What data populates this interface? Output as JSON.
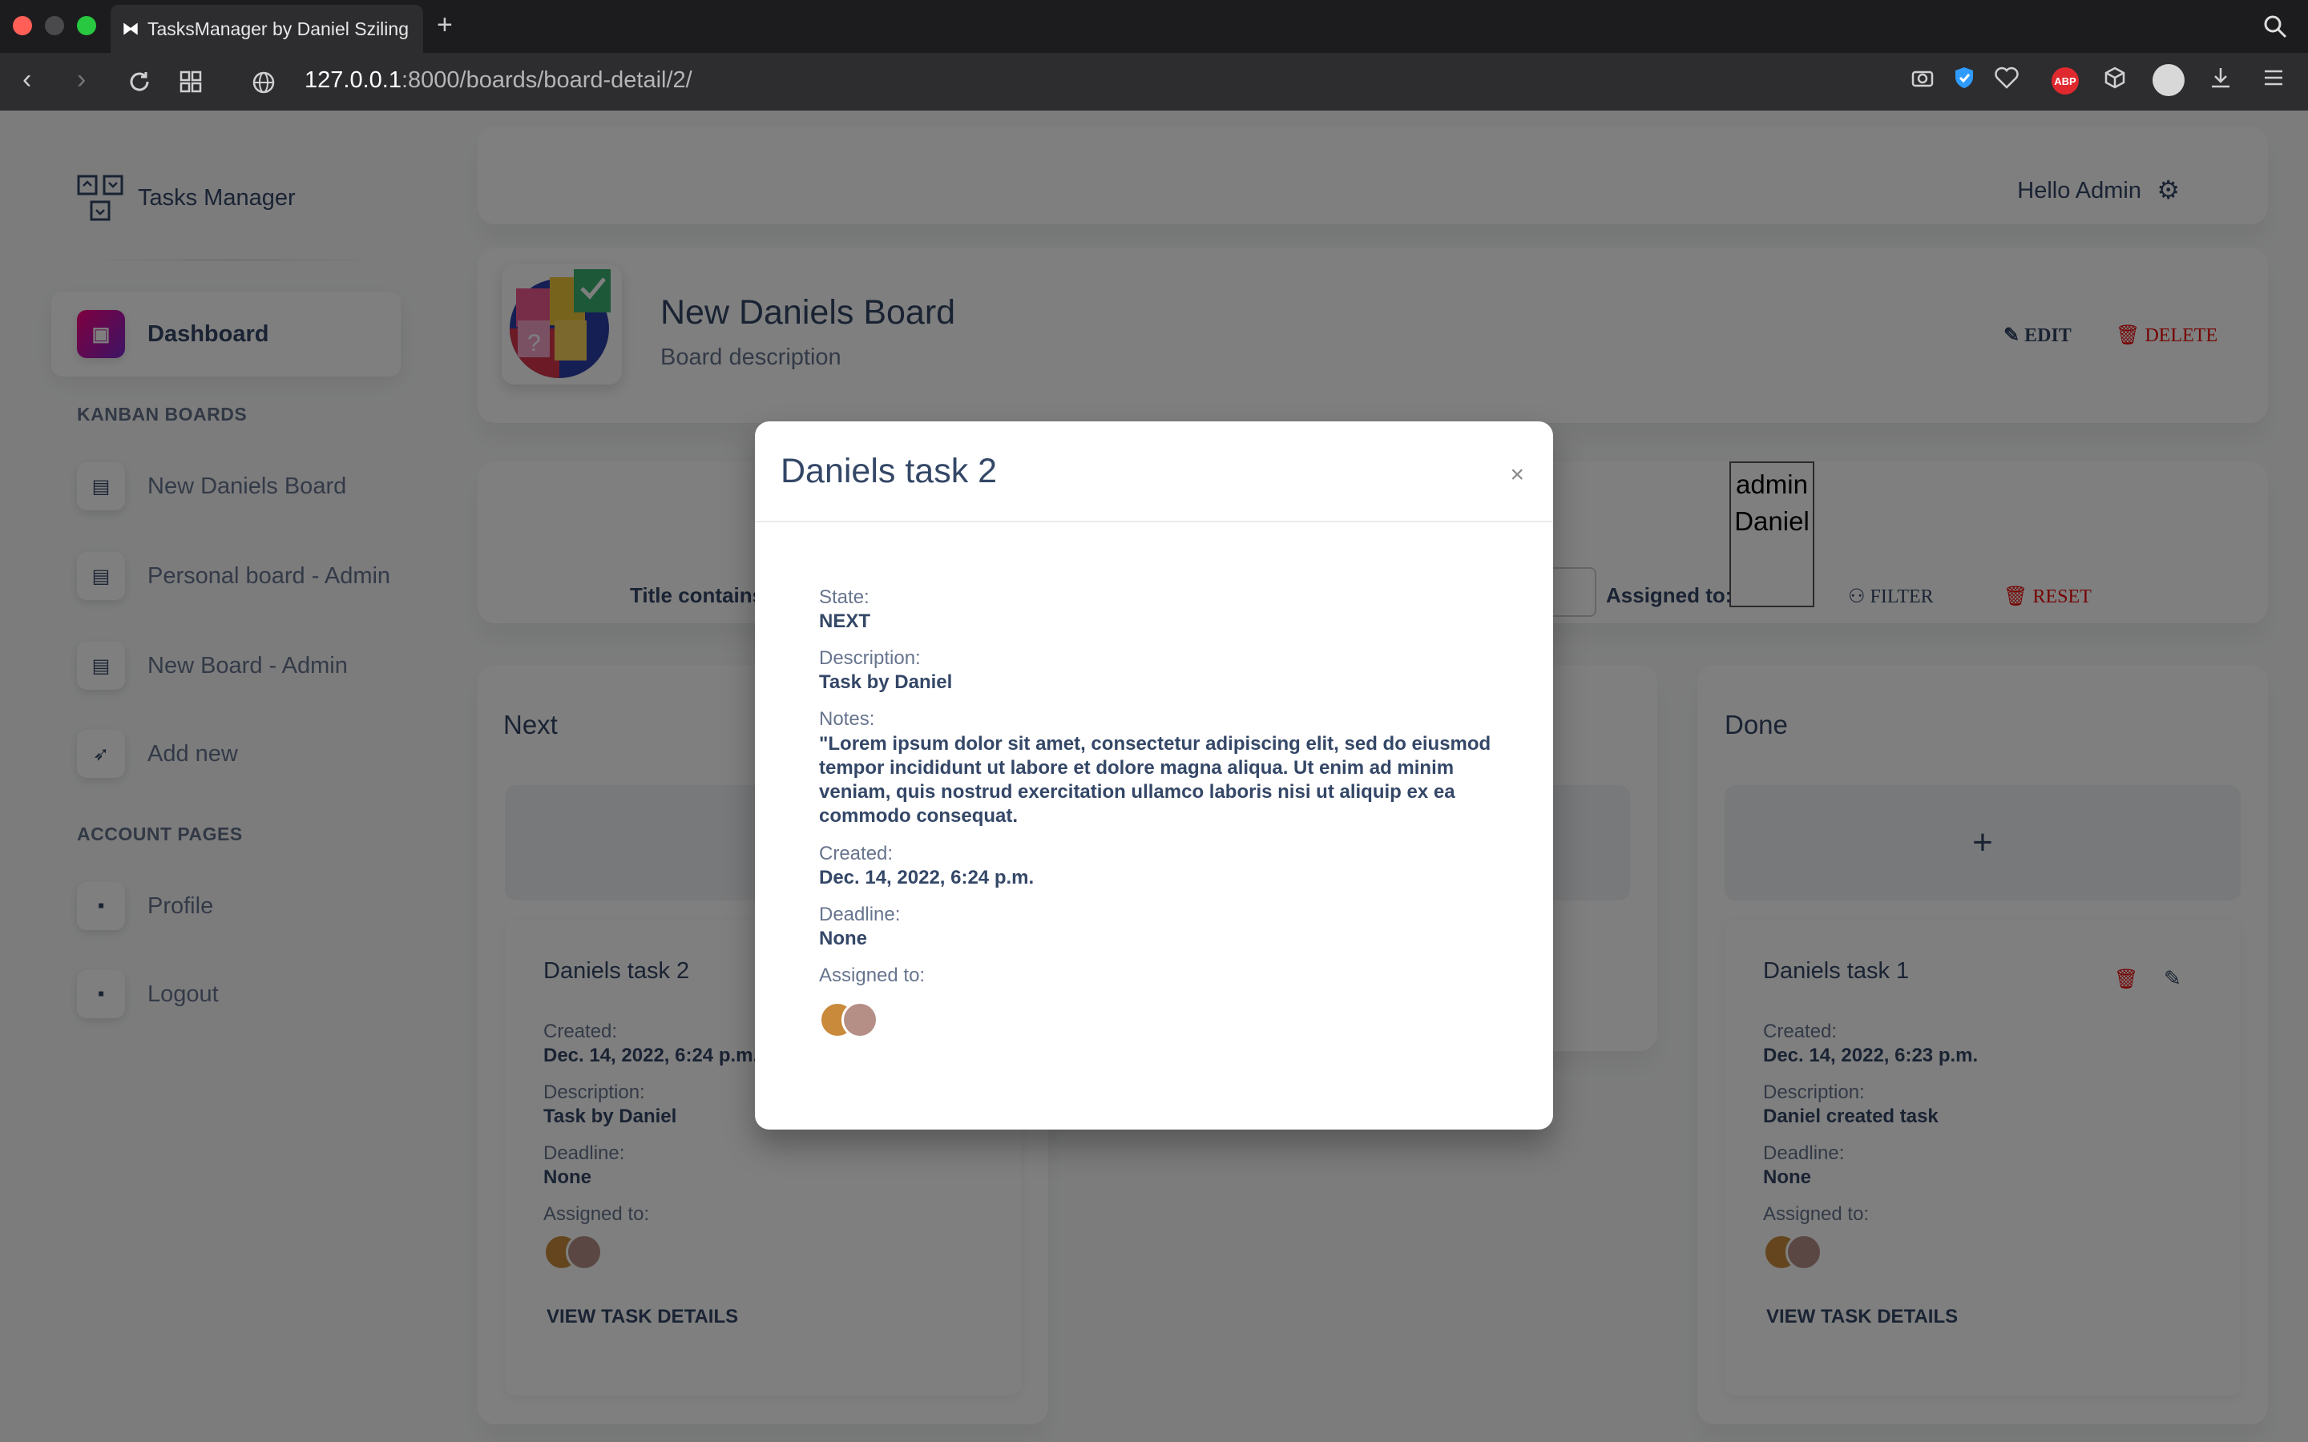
{
  "browser": {
    "tab_title": "TasksManager by Daniel Sziling",
    "url_host": "127.0.0.1",
    "url_path": ":8000/boards/board-detail/2/"
  },
  "sidebar": {
    "brand": "Tasks Manager",
    "dashboard": "Dashboard",
    "kanban_heading": "KANBAN BOARDS",
    "boards": [
      {
        "label": "New Daniels Board"
      },
      {
        "label": "Personal board - Admin"
      },
      {
        "label": "New Board - Admin"
      },
      {
        "label": "Add new"
      }
    ],
    "account_heading": "ACCOUNT PAGES",
    "account": [
      {
        "label": "Profile"
      },
      {
        "label": "Logout"
      }
    ]
  },
  "header": {
    "greeting": "Hello Admin"
  },
  "board": {
    "title": "New Daniels Board",
    "description": "Board description",
    "edit": "EDIT",
    "delete": "DELETE"
  },
  "filter": {
    "title_label": "Title contains",
    "assigned_label": "Assigned to:",
    "options": [
      "admin",
      "Daniel"
    ],
    "filter_btn": "FILTER",
    "reset_btn": "RESET"
  },
  "columns": {
    "next": {
      "title": "Next",
      "task": {
        "name": "Daniels task 2",
        "created_label": "Created:",
        "created": "Dec. 14, 2022, 6:24 p.m.",
        "desc_label": "Description:",
        "desc": "Task by Daniel",
        "deadline_label": "Deadline:",
        "deadline": "None",
        "assigned_label": "Assigned to:",
        "view": "VIEW TASK DETAILS"
      }
    },
    "done": {
      "title": "Done",
      "add": "+",
      "task": {
        "name": "Daniels task 1",
        "created_label": "Created:",
        "created": "Dec. 14, 2022, 6:23 p.m.",
        "desc_label": "Description:",
        "desc": "Daniel created task",
        "deadline_label": "Deadline:",
        "deadline": "None",
        "assigned_label": "Assigned to:",
        "view": "VIEW TASK DETAILS"
      }
    }
  },
  "modal": {
    "title": "Daniels task 2",
    "close": "×",
    "state_label": "State:",
    "state": "NEXT",
    "desc_label": "Description:",
    "desc": "Task by Daniel",
    "notes_label": "Notes:",
    "notes": "\"Lorem ipsum dolor sit amet, consectetur adipiscing elit, sed do eiusmod tempor incididunt ut labore et dolore magna aliqua. Ut enim ad minim veniam, quis nostrud exercitation ullamco laboris nisi ut aliquip ex ea commodo consequat.",
    "created_label": "Created:",
    "created": "Dec. 14, 2022, 6:24 p.m.",
    "deadline_label": "Deadline:",
    "deadline": "None",
    "assigned_label": "Assigned to:"
  },
  "colors": {
    "primary_text": "#344767",
    "secondary_text": "#67748e",
    "danger": "#ea0606",
    "active_gradient_start": "#7928ca",
    "active_gradient_end": "#ff0080"
  }
}
